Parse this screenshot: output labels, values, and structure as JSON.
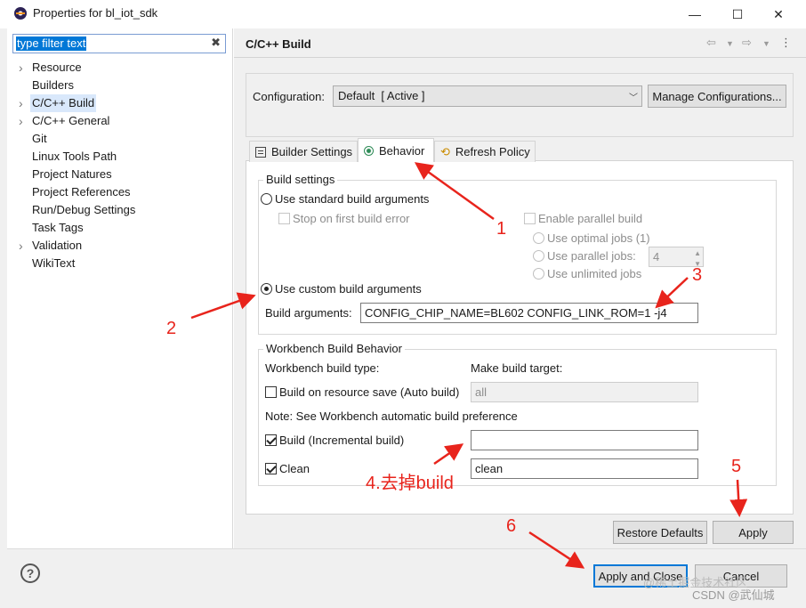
{
  "window": {
    "title": "Properties for bl_iot_sdk",
    "minimize_glyph": "—",
    "maximize_glyph": "☐",
    "close_glyph": "✕"
  },
  "filter": {
    "value": "type filter text",
    "clear_glyph": "✖"
  },
  "tree": {
    "items": [
      {
        "label": "Resource",
        "expandable": true
      },
      {
        "label": "Builders",
        "expandable": false
      },
      {
        "label": "C/C++ Build",
        "expandable": true,
        "selected": true
      },
      {
        "label": "C/C++ General",
        "expandable": true
      },
      {
        "label": "Git",
        "expandable": false
      },
      {
        "label": "Linux Tools Path",
        "expandable": false
      },
      {
        "label": "Project Natures",
        "expandable": false
      },
      {
        "label": "Project References",
        "expandable": false
      },
      {
        "label": "Run/Debug Settings",
        "expandable": false
      },
      {
        "label": "Task Tags",
        "expandable": false
      },
      {
        "label": "Validation",
        "expandable": true
      },
      {
        "label": "WikiText",
        "expandable": false
      }
    ]
  },
  "header": {
    "title": "C/C++ Build"
  },
  "config": {
    "label": "Configuration:",
    "selected": "Default  [ Active ]",
    "manage_label": "Manage Configurations..."
  },
  "tabs": [
    {
      "label": "Builder Settings",
      "icon": "list-icon"
    },
    {
      "label": "Behavior",
      "icon": "radio-icon",
      "active": true
    },
    {
      "label": "Refresh Policy",
      "icon": "refresh-icon"
    }
  ],
  "build_settings": {
    "title": "Build settings",
    "use_standard": "Use standard build arguments",
    "stop_on_error": "Stop on first build error",
    "enable_parallel": "Enable parallel build",
    "use_optimal": "Use optimal jobs (1)",
    "use_parallel_jobs": "Use parallel jobs:",
    "parallel_jobs_value": "4",
    "use_unlimited": "Use unlimited jobs",
    "use_custom": "Use custom build arguments",
    "build_args_label": "Build arguments:",
    "build_args_value": "CONFIG_CHIP_NAME=BL602 CONFIG_LINK_ROM=1 -j4"
  },
  "workbench": {
    "title": "Workbench Build Behavior",
    "build_type_label": "Workbench build type:",
    "make_target_label": "Make build target:",
    "auto_build_label": "Build on resource save (Auto build)",
    "auto_build_value": "all",
    "note": "Note: See Workbench automatic build preference",
    "incremental_label": "Build (Incremental build)",
    "incremental_value": "",
    "clean_label": "Clean",
    "clean_value": "clean"
  },
  "buttons": {
    "restore_defaults": "Restore Defaults",
    "apply": "Apply",
    "apply_and_close": "Apply and Close",
    "cancel": "Cancel"
  },
  "annotations": {
    "a1": "1",
    "a2": "2",
    "a3": "3",
    "a4": "4.去掉build",
    "a5": "5",
    "a6": "6"
  },
  "watermark": {
    "line1": "@稀土掘金技术社区",
    "line2": "CSDN @武仙城"
  },
  "colors": {
    "annotation_red": "#e8241c",
    "selection_blue": "#0078d7",
    "tree_selected": "#d9e8fb"
  }
}
